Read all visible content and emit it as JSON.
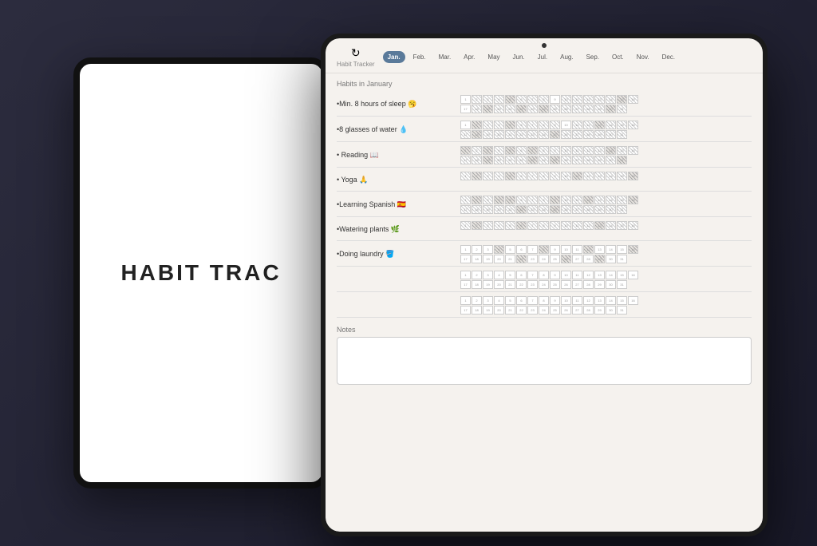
{
  "scene": {
    "background_tablet": {
      "text": "HABIT TRAC"
    }
  },
  "app": {
    "title": "Habit Tracker",
    "icon_label": "↻"
  },
  "months": [
    {
      "label": "Jan.",
      "active": true
    },
    {
      "label": "Feb.",
      "active": false
    },
    {
      "label": "Mar.",
      "active": false
    },
    {
      "label": "Apr.",
      "active": false
    },
    {
      "label": "May",
      "active": false
    },
    {
      "label": "Jun.",
      "active": false
    },
    {
      "label": "Jul.",
      "active": false
    },
    {
      "label": "Aug.",
      "active": false
    },
    {
      "label": "Sep.",
      "active": false
    },
    {
      "label": "Oct.",
      "active": false
    },
    {
      "label": "Nov.",
      "active": false
    },
    {
      "label": "Dec.",
      "active": false
    }
  ],
  "section_title": "Habits in January",
  "habits": [
    {
      "label": "•Min. 8 hours of sleep 🥱"
    },
    {
      "label": "•8 glasses of water 💧"
    },
    {
      "label": "• Reading 📖"
    },
    {
      "label": "• Yoga 🙏"
    },
    {
      "label": "•Learning Spanish 🇪🇸"
    },
    {
      "label": "•Watering plants 🌿"
    },
    {
      "label": "•Doing laundry 🪣"
    }
  ],
  "notes_label": "Notes"
}
